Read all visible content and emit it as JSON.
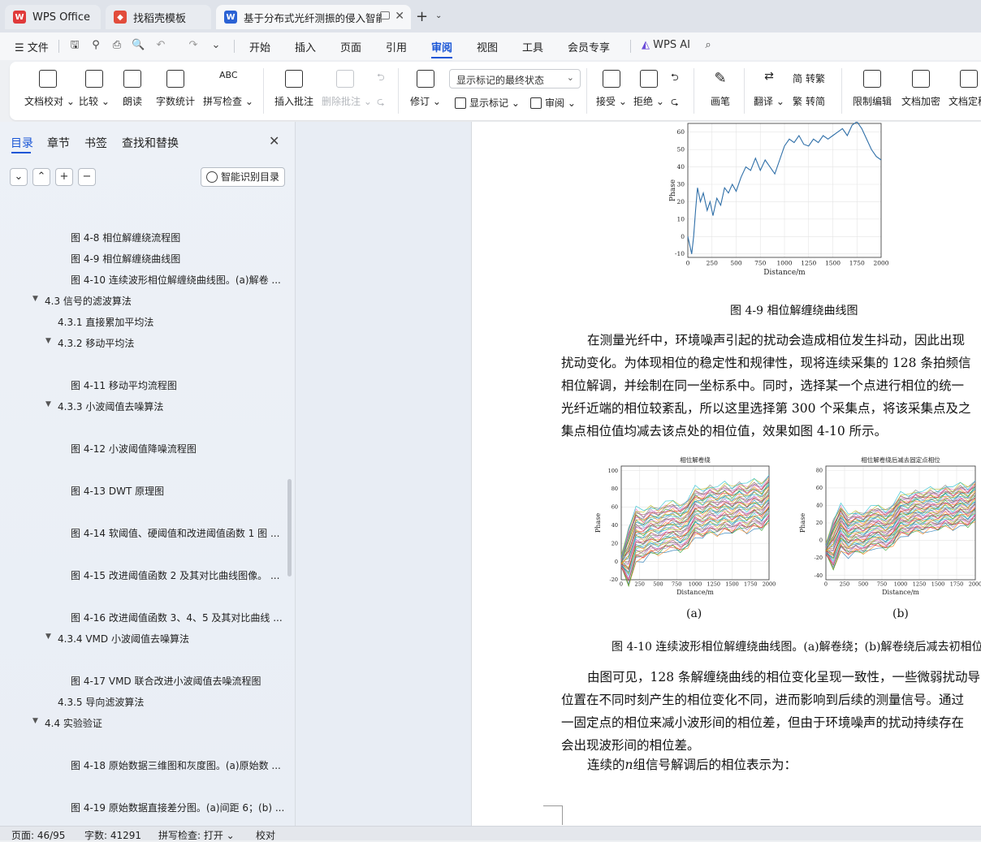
{
  "tabs": [
    {
      "label": "WPS Office",
      "icon": "wps-logo-icon"
    },
    {
      "label": "找稻壳模板",
      "icon": "docer-icon"
    },
    {
      "label": "基于分布式光纤测振的侵入智能",
      "icon": "word-doc-icon"
    }
  ],
  "menu": {
    "file": "文件",
    "items": [
      "开始",
      "插入",
      "页面",
      "引用",
      "审阅",
      "视图",
      "工具",
      "会员专享"
    ],
    "active": "审阅",
    "ai": "WPS AI"
  },
  "ribbon": {
    "doc_check": "文档校对",
    "compare": "比较",
    "read_aloud": "朗读",
    "word_count": "字数统计",
    "spell_check": "拼写检查",
    "insert_comment": "插入批注",
    "delete_comment": "删除批注",
    "revise": "修订",
    "markup_state": "显示标记的最终状态",
    "show_markup": "显示标记",
    "review": "审阅",
    "accept": "接受",
    "reject": "拒绝",
    "pen": "画笔",
    "translate": "翻译",
    "to_traditional": "转繁",
    "to_simplified": "转简",
    "restrict_edit": "限制编辑",
    "encrypt": "文档加密",
    "finalize": "文档定稿",
    "icon_simplified": "简",
    "icon_traditional": "繁"
  },
  "nav": {
    "tabs": [
      "目录",
      "章节",
      "书签",
      "查找和替换"
    ],
    "smart_toc": "智能识别目录",
    "items": [
      {
        "text": "图 4-8  相位解缠绕流程图",
        "level": 3
      },
      {
        "text": "图 4-9  相位解缠绕曲线图",
        "level": 3
      },
      {
        "text": "图 4-10  连续波形相位解缠绕曲线图。(a)解卷 ...",
        "level": 3
      },
      {
        "text": "4.3  信号的滤波算法",
        "level": 1,
        "expanded": true
      },
      {
        "text": "4.3.1  直接累加平均法",
        "level": 2
      },
      {
        "text": "4.3.2  移动平均法",
        "level": 2,
        "expanded": true
      },
      {
        "text": "图 4-11  移动平均流程图",
        "level": 3
      },
      {
        "text": "4.3.3  小波阈值去噪算法",
        "level": 2,
        "expanded": true
      },
      {
        "text": "图 4-12  小波阈值降噪流程图",
        "level": 3
      },
      {
        "text": "图 4-13  DWT 原理图",
        "level": 3
      },
      {
        "text": "图 4-14  软阈值、硬阈值和改进阈值函数 1 图 ...",
        "level": 3
      },
      {
        "text": "图 4-15  改进阈值函数 2 及其对比曲线图像。 ...",
        "level": 3
      },
      {
        "text": "图 4-16  改进阈值函数 3、4、5 及其对比曲线 ...",
        "level": 3
      },
      {
        "text": "4.3.4 VMD 小波阈值去噪算法",
        "level": 2,
        "expanded": true
      },
      {
        "text": "图 4-17  VMD 联合改进小波阈值去噪流程图",
        "level": 3
      },
      {
        "text": "4.3.5  导向滤波算法",
        "level": 2
      },
      {
        "text": "4.4  实验验证",
        "level": 1,
        "expanded": true
      },
      {
        "text": "图 4-18  原始数据三维图和灰度图。(a)原始数 ...",
        "level": 3
      },
      {
        "text": "图 4-19  原始数据直接差分图。(a)间距 6；(b) ...",
        "level": 3
      }
    ]
  },
  "doc": {
    "fig49_caption": "图 4-9  相位解缠绕曲线图",
    "para1": [
      "在测量光纤中，环境噪声引起的扰动会造成相位发生抖动，因此出现",
      "扰动变化。为体现相位的稳定性和规律性，现将连续采集的 128 条拍频信",
      "相位解调，并绘制在同一坐标系中。同时，选择某一个点进行相位的统一",
      "光纤近端的相位较紊乱，所以这里选择第 300 个采集点，将该采集点及之",
      "集点相位值均减去该点处的相位值，效果如图 4-10 所示。"
    ],
    "fig410_caption": "图 4-10  连续波形相位解缠绕曲线图。(a)解卷绕；(b)解卷绕后减去初相位",
    "sub_a": "(a)",
    "sub_b": "(b)",
    "para2": [
      "由图可见，128 条解缠绕曲线的相位变化呈现一致性，一些微弱扰动导",
      "位置在不同时刻产生的相位变化不同，进而影响到后续的测量信号。通过",
      "一固定点的相位来减小波形间的相位差，但由于环境噪声的扰动持续存在",
      "会出现波形间的相位差。"
    ],
    "para3_prefix": "连续的",
    "para3_var": "n",
    "para3_suffix": "组信号解调后的相位表示为："
  },
  "chart_data": [
    {
      "type": "line",
      "title": "",
      "xlabel": "Distance/m",
      "ylabel": "Phase",
      "xlim": [
        0,
        2000
      ],
      "ylim": [
        -12,
        65
      ],
      "x_ticks": [
        0,
        250,
        500,
        750,
        1000,
        1250,
        1500,
        1750,
        2000
      ],
      "y_ticks": [
        -10,
        0,
        10,
        20,
        30,
        40,
        50,
        60
      ],
      "color": "#2f6fa8",
      "x": [
        0,
        20,
        40,
        60,
        80,
        100,
        130,
        160,
        200,
        230,
        260,
        300,
        340,
        380,
        420,
        460,
        500,
        550,
        600,
        650,
        700,
        750,
        800,
        850,
        900,
        950,
        1000,
        1050,
        1100,
        1150,
        1200,
        1250,
        1300,
        1350,
        1400,
        1450,
        1500,
        1550,
        1600,
        1650,
        1700,
        1750,
        1800,
        1850,
        1900,
        1950,
        2000
      ],
      "y": [
        0,
        -5,
        -10,
        0,
        15,
        28,
        20,
        25,
        15,
        20,
        12,
        22,
        18,
        28,
        25,
        30,
        26,
        34,
        40,
        38,
        45,
        38,
        44,
        40,
        36,
        44,
        52,
        56,
        54,
        58,
        53,
        52,
        56,
        54,
        58,
        56,
        58,
        60,
        62,
        58,
        64,
        66,
        62,
        56,
        50,
        46,
        44
      ]
    },
    {
      "type": "line",
      "title": "相位解卷绕",
      "xlabel": "Distance/m",
      "ylabel": "Phase",
      "xlim": [
        0,
        2000
      ],
      "ylim": [
        -20,
        105
      ],
      "x_ticks": [
        0,
        250,
        500,
        750,
        1000,
        1250,
        1500,
        1750,
        2000
      ],
      "y_ticks": [
        -20,
        0,
        20,
        40,
        60,
        80,
        100
      ],
      "x": [
        0,
        100,
        200,
        300,
        400,
        500,
        600,
        700,
        800,
        900,
        1000,
        1100,
        1200,
        1300,
        1400,
        1500,
        1600,
        1700,
        1800,
        1900,
        2000
      ],
      "series_base": [
        0,
        5,
        30,
        28,
        35,
        33,
        38,
        40,
        36,
        42,
        55,
        52,
        58,
        55,
        60,
        56,
        62,
        58,
        64,
        60,
        70
      ],
      "series_count": 128,
      "spread": 45
    },
    {
      "type": "line",
      "title": "相位解卷绕后减去固定点相位",
      "xlabel": "Distance/m",
      "ylabel": "Phase",
      "xlim": [
        0,
        2000
      ],
      "ylim": [
        -45,
        85
      ],
      "x_ticks": [
        0,
        250,
        500,
        750,
        1000,
        1250,
        1500,
        1750,
        2000
      ],
      "y_ticks": [
        -40,
        -20,
        0,
        20,
        40,
        60,
        80
      ],
      "x": [
        0,
        100,
        200,
        300,
        400,
        500,
        600,
        700,
        800,
        900,
        1000,
        1100,
        1200,
        1300,
        1400,
        1500,
        1600,
        1700,
        1800,
        1900,
        2000
      ],
      "series_base": [
        -10,
        -5,
        15,
        5,
        10,
        8,
        14,
        16,
        12,
        18,
        30,
        28,
        34,
        32,
        36,
        34,
        40,
        36,
        42,
        38,
        46
      ],
      "series_count": 128,
      "spread": 40
    }
  ],
  "status": {
    "page": "页面: 46/95",
    "words": "字数: 41291",
    "spell": "拼写检查: 打开",
    "proof": "校对"
  }
}
